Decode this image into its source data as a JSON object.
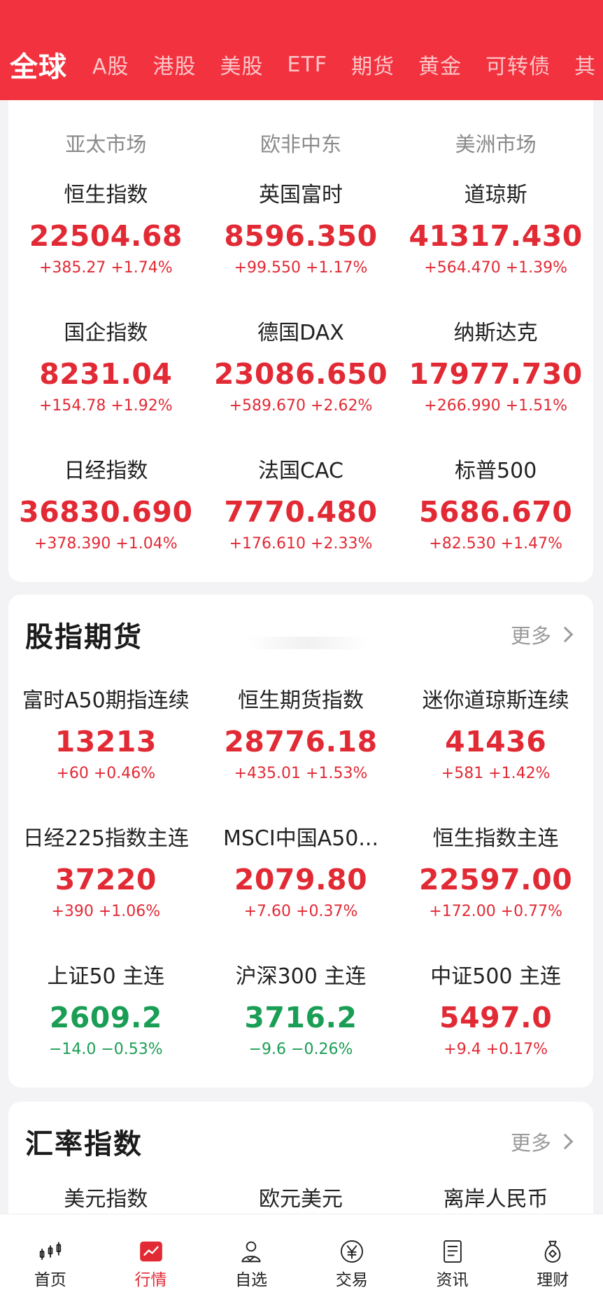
{
  "tabs": [
    "全球",
    "A股",
    "港股",
    "美股",
    "ETF",
    "期货",
    "黄金",
    "可转债",
    "其"
  ],
  "colors": {
    "header": "#f2323f",
    "up": "#e22a35",
    "down": "#1a9e55"
  },
  "global_markets": {
    "regions": [
      "亚太市场",
      "欧非中东",
      "美洲市场"
    ],
    "items": [
      {
        "name": "恒生指数",
        "price": "22504.68",
        "change": "+385.27 +1.74%",
        "dir": "up"
      },
      {
        "name": "英国富时",
        "price": "8596.350",
        "change": "+99.550 +1.17%",
        "dir": "up"
      },
      {
        "name": "道琼斯",
        "price": "41317.430",
        "change": "+564.470 +1.39%",
        "dir": "up"
      },
      {
        "name": "国企指数",
        "price": "8231.04",
        "change": "+154.78 +1.92%",
        "dir": "up"
      },
      {
        "name": "德国DAX",
        "price": "23086.650",
        "change": "+589.670 +2.62%",
        "dir": "up"
      },
      {
        "name": "纳斯达克",
        "price": "17977.730",
        "change": "+266.990 +1.51%",
        "dir": "up"
      },
      {
        "name": "日经指数",
        "price": "36830.690",
        "change": "+378.390 +1.04%",
        "dir": "up"
      },
      {
        "name": "法国CAC",
        "price": "7770.480",
        "change": "+176.610 +2.33%",
        "dir": "up"
      },
      {
        "name": "标普500",
        "price": "5686.670",
        "change": "+82.530 +1.47%",
        "dir": "up"
      }
    ]
  },
  "futures": {
    "title": "股指期货",
    "more": "更多",
    "items": [
      {
        "name": "富时A50期指连续",
        "price": "13213",
        "change": "+60 +0.46%",
        "dir": "up"
      },
      {
        "name": "恒生期货指数",
        "price": "28776.18",
        "change": "+435.01 +1.53%",
        "dir": "up"
      },
      {
        "name": "迷你道琼斯连续",
        "price": "41436",
        "change": "+581 +1.42%",
        "dir": "up"
      },
      {
        "name": "日经225指数主连",
        "price": "37220",
        "change": "+390 +1.06%",
        "dir": "up"
      },
      {
        "name": "MSCI中国A50...",
        "price": "2079.80",
        "change": "+7.60 +0.37%",
        "dir": "up"
      },
      {
        "name": "恒生指数主连",
        "price": "22597.00",
        "change": "+172.00 +0.77%",
        "dir": "up"
      },
      {
        "name": "上证50 主连",
        "price": "2609.2",
        "change": "−14.0 −0.53%",
        "dir": "down"
      },
      {
        "name": "沪深300 主连",
        "price": "3716.2",
        "change": "−9.6 −0.26%",
        "dir": "down"
      },
      {
        "name": "中证500 主连",
        "price": "5497.0",
        "change": "+9.4 +0.17%",
        "dir": "up"
      }
    ]
  },
  "fx": {
    "title": "汇率指数",
    "more": "更多",
    "items": [
      "美元指数",
      "欧元美元",
      "离岸人民币"
    ]
  },
  "nav": [
    {
      "label": "首页",
      "icon": "home-candlestick-icon"
    },
    {
      "label": "行情",
      "icon": "market-chart-icon"
    },
    {
      "label": "自选",
      "icon": "watchlist-person-icon"
    },
    {
      "label": "交易",
      "icon": "yen-trade-icon"
    },
    {
      "label": "资讯",
      "icon": "news-document-icon"
    },
    {
      "label": "理财",
      "icon": "money-bag-icon"
    }
  ]
}
